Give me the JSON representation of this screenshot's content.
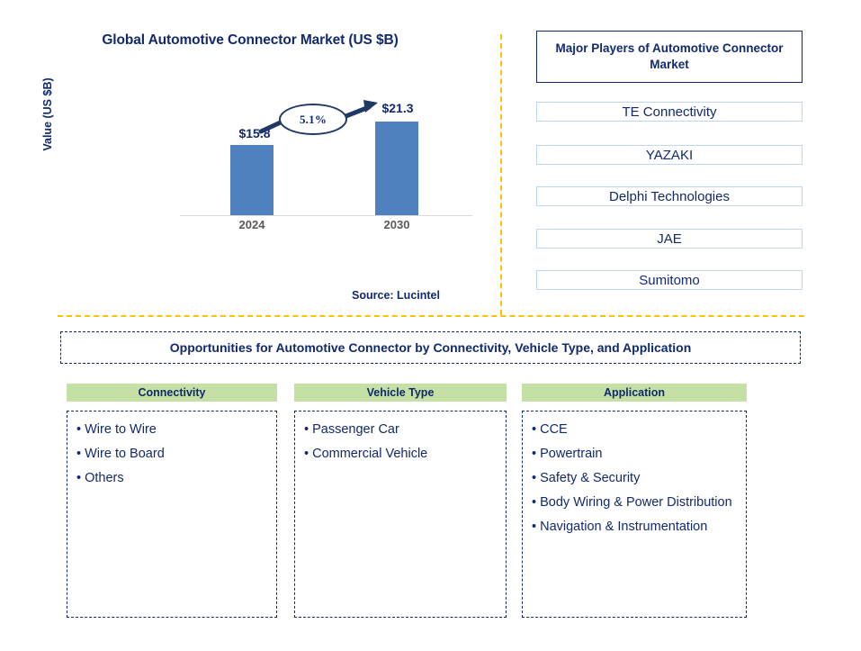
{
  "chart_data": {
    "type": "bar",
    "title": "Global Automotive Connector Market (US $B)",
    "xlabel": "",
    "ylabel": "Value (US $B)",
    "categories": [
      "2024",
      "2030"
    ],
    "values": [
      15.8,
      21.3
    ],
    "data_labels": [
      "$15.8",
      "$21.3"
    ],
    "annotation": "5.1%",
    "annotation_type": "CAGR callout ellipse with arrow",
    "grid": false,
    "legend": "none",
    "ylim": [
      0,
      24
    ],
    "bar_color": "#4E81BD",
    "source": "Source: Lucintel"
  },
  "chart_panel": {
    "title": "Global Automotive Connector Market (US $B)",
    "y_axis_label": "Value (US $B)",
    "bars": [
      {
        "tick": "2024",
        "label": "$15.8"
      },
      {
        "tick": "2030",
        "label": "$21.3"
      }
    ],
    "cagr": "5.1%",
    "source": "Source: Lucintel"
  },
  "players_panel": {
    "title": "Major Players of Automotive Connector Market",
    "items": [
      {
        "name": "TE Connectivity"
      },
      {
        "name": "YAZAKI"
      },
      {
        "name": "Delphi Technologies"
      },
      {
        "name": "JAE"
      },
      {
        "name": "Sumitomo"
      }
    ]
  },
  "opportunities": {
    "banner": "Opportunities for Automotive Connector by Connectivity, Vehicle Type, and Application",
    "columns": [
      {
        "header": "Connectivity",
        "items": [
          "Wire to Wire",
          "Wire to Board",
          "Others"
        ]
      },
      {
        "header": "Vehicle Type",
        "items": [
          "Passenger Car",
          "Commercial Vehicle"
        ]
      },
      {
        "header": "Application",
        "items": [
          "CCE",
          "Powertrain",
          "Safety & Security",
          "Body Wiring & Power Distribution",
          "Navigation & Instrumentation"
        ]
      }
    ]
  },
  "colors": {
    "navy": "#12296B",
    "bar_blue": "#4E81BD",
    "header_green": "#C5E0A5",
    "divider_gold": "#FFC000",
    "player_border": "#BDD7EE",
    "tick_gray": "#595959"
  }
}
